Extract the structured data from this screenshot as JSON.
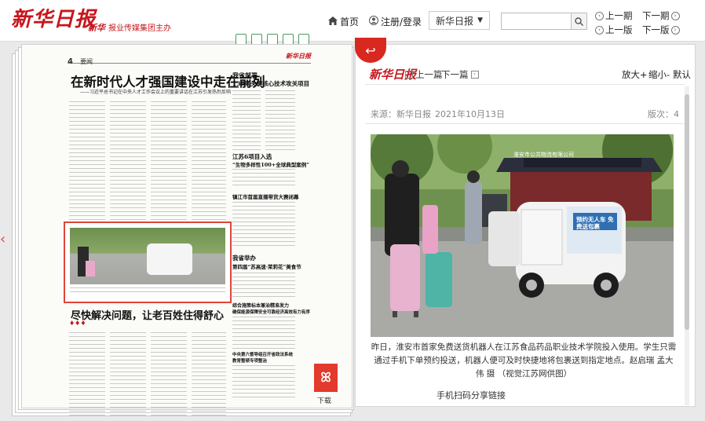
{
  "header": {
    "logo": "新华日报",
    "logo_sub_mini": "新华",
    "logo_sub": "报业传媒集团主办",
    "home": "首页",
    "login": "注册/登录",
    "paper_select": "新华日报",
    "search_placeholder": "",
    "prev_issue": "上一期",
    "next_issue": "下一期",
    "prev_page": "上一版",
    "next_page": "下一版"
  },
  "page": {
    "number": "4",
    "section": "要闻",
    "headline_main": "在新时代人才强国建设中走在前列",
    "headline_sub": "——习近平总书记在中央人才工作会议上的重要讲话在江苏引发热烈反响",
    "side_head_1": "我省部署",
    "side_head_2": "136项关键核心技术攻关项目",
    "side_head_3": "江苏6项目入选",
    "side_head_4": "“生物多样性100+全球典型案例”",
    "side_head_5": "镇江市首届直播带货大赛闭幕",
    "side_head_6": "我省举办",
    "side_head_7": "第四届“苏高速·茉莉花”美食节",
    "side_head_8": "综合施策标本兼治精准发力",
    "side_head_9": "确保能源保障安全可靠经济高效有力有序",
    "side_head_10": "中央第六督导组召开省政法系统",
    "side_head_11": "教育整顿专项整治",
    "bottom_head": "尽快解决问题，让老百姓住得舒心",
    "pdf_label": "下载"
  },
  "article": {
    "logo": "新华日报",
    "prev_article": "上一篇",
    "next_article": "下一篇",
    "zoom_in": "放大+",
    "zoom_out": "缩小-",
    "default": "默认",
    "source": "来源：新华日报",
    "date": "2021年10月13日",
    "edition": "版次：4",
    "caption": "昨日，淮安市首家免费送货机器人在江苏食品药品职业技术学院投入使用。学生只需通过手机下单预约投送，机器人便可及时快捷地将包裹送到指定地点。赵启瑞 孟大伟 摄 （视觉江苏网供图）",
    "share": "手机扫码分享链接",
    "robot_sign": "预约无人车 免费送包裹",
    "banner": "淮安市公共物流有限公司"
  }
}
